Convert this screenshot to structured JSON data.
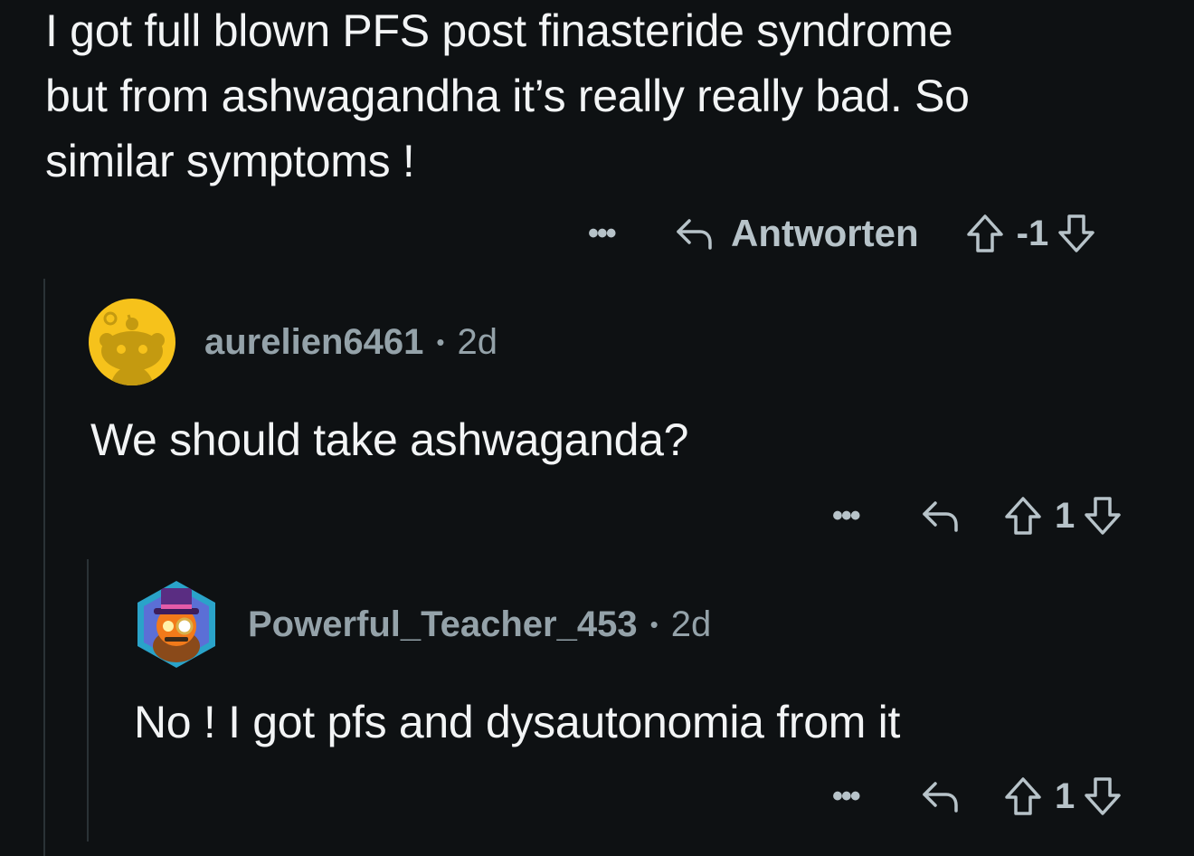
{
  "top_comment": {
    "text_line1": "I got full blown PFS post finasteride syndrome",
    "text_line2": "but from ashwagandha it’s really really bad. So",
    "text_line3": "similar symptoms !",
    "more_label": "•••",
    "reply_label": "Antworten",
    "score": "-1"
  },
  "reply1": {
    "avatar_icon": "snoo-avatar-icon",
    "username": "aurelien6461",
    "separator": "•",
    "age": "2d",
    "text": "We should take ashwaganda?",
    "more_label": "•••",
    "score": "1"
  },
  "reply2": {
    "avatar_icon": "top-hat-avatar-icon",
    "username": "Powerful_Teacher_453",
    "separator": "•",
    "age": "2d",
    "text": "No ! I got pfs and dysautonomia from it",
    "more_label": "•••",
    "score": "1"
  },
  "colors": {
    "background": "#0e1113",
    "text": "#f2f4f5",
    "muted": "#b7c3c9",
    "thread_line": "#2a3236",
    "avatar_yellow": "#f6c21b"
  }
}
